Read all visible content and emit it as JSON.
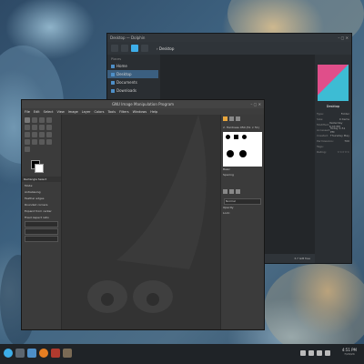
{
  "file_manager": {
    "title": "Desktop — Dolphin",
    "breadcrumb": "Desktop",
    "sidebar_heading": "Places",
    "sidebar_items": [
      {
        "label": "Home",
        "selected": false
      },
      {
        "label": "Desktop",
        "selected": true
      },
      {
        "label": "Documents",
        "selected": false
      },
      {
        "label": "Downloads",
        "selected": false
      }
    ],
    "status_text": "3.7 GiB free",
    "info_title": "Desktop",
    "info_rows": [
      {
        "k": "Type:",
        "v": "Folder"
      },
      {
        "k": "Size:",
        "v": "0 items"
      },
      {
        "k": "Modified:",
        "v": "Yesterday 6:43 PM"
      },
      {
        "k": "Accessed:",
        "v": "Today 4:51 PM"
      },
      {
        "k": "Created:",
        "v": "Thursday May"
      },
      {
        "k": "Permissions:",
        "v": "700"
      },
      {
        "k": "Tags:",
        "v": ""
      },
      {
        "k": "Rating:",
        "v": "☆☆☆☆☆"
      }
    ]
  },
  "gimp": {
    "title": "GNU Image Manipulation Program",
    "menu": [
      "File",
      "Edit",
      "Select",
      "View",
      "Image",
      "Layer",
      "Colors",
      "Tools",
      "Filters",
      "Windows",
      "Help"
    ],
    "tool_options_title": "Rectangle Select",
    "options": [
      {
        "label": "Mode:"
      },
      {
        "label": "Antialiasing"
      },
      {
        "label": "Feather edges"
      },
      {
        "label": "Rounded corners"
      },
      {
        "label": "Expand from center"
      },
      {
        "label": "Fixed  Aspect ratio"
      }
    ],
    "brush_label": "2. Hardness 050 (51 × 51)",
    "brush_filter": "Basic",
    "spacing_label": "Spacing",
    "layers_mode": "Normal",
    "layers_opacity": "Opacity",
    "lock_label": "Lock:"
  },
  "taskbar": {
    "time": "4:51 PM",
    "date": "7/29/24"
  },
  "colors": {
    "accent": "#3daee9",
    "selection": "#3b5f80"
  }
}
